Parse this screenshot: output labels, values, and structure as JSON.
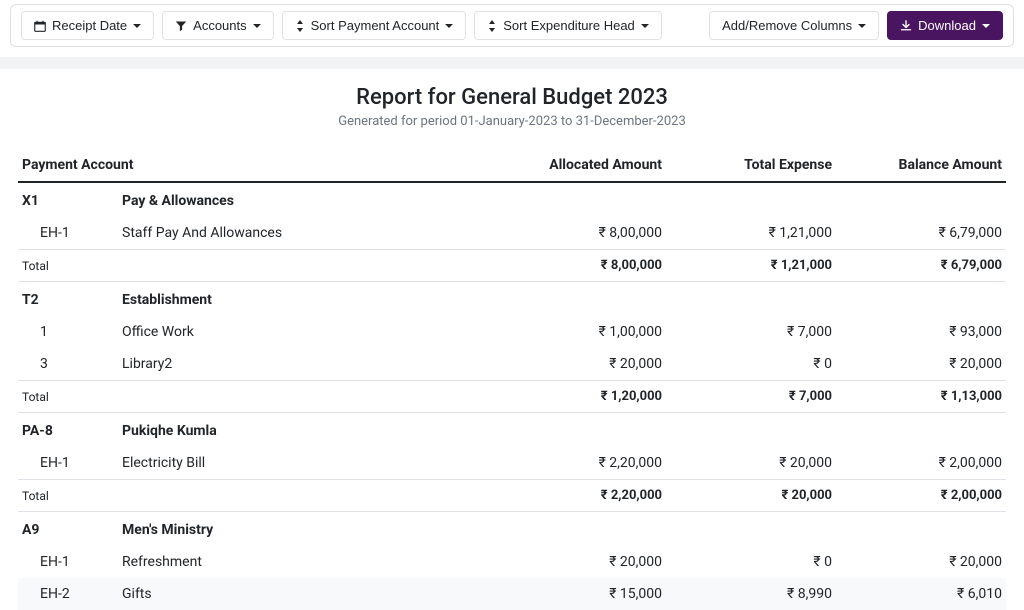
{
  "toolbar": {
    "receipt_date": "Receipt Date",
    "accounts": "Accounts",
    "sort_payment_account": "Sort Payment Account",
    "sort_expenditure_head": "Sort Expenditure Head",
    "add_remove_columns": "Add/Remove Columns",
    "download": "Download"
  },
  "report": {
    "title": "Report for General Budget 2023",
    "subtitle": "Generated for period 01-January-2023 to 31-December-2023"
  },
  "columns": {
    "payment_account": "Payment Account",
    "allocated_amount": "Allocated Amount",
    "total_expense": "Total Expense",
    "balance_amount": "Balance Amount"
  },
  "groups": [
    {
      "code": "X1",
      "name": "Pay & Allowances",
      "rows": [
        {
          "code": "EH-1",
          "label": "Staff Pay And Allowances",
          "allocated": "₹ 8,00,000",
          "expense": "₹ 1,21,000",
          "balance": "₹ 6,79,000"
        }
      ],
      "total": {
        "label": "Total",
        "allocated": "₹ 8,00,000",
        "expense": "₹ 1,21,000",
        "balance": "₹ 6,79,000"
      }
    },
    {
      "code": "T2",
      "name": "Establishment",
      "rows": [
        {
          "code": "1",
          "label": "Office Work",
          "allocated": "₹ 1,00,000",
          "expense": "₹ 7,000",
          "balance": "₹ 93,000"
        },
        {
          "code": "3",
          "label": "Library2",
          "allocated": "₹ 20,000",
          "expense": "₹ 0",
          "balance": "₹ 20,000"
        }
      ],
      "total": {
        "label": "Total",
        "allocated": "₹ 1,20,000",
        "expense": "₹ 7,000",
        "balance": "₹ 1,13,000"
      }
    },
    {
      "code": "PA-8",
      "name": "Pukiqhe Kumla",
      "rows": [
        {
          "code": "EH-1",
          "label": "Electricity Bill",
          "allocated": "₹ 2,20,000",
          "expense": "₹ 20,000",
          "balance": "₹ 2,00,000"
        }
      ],
      "total": {
        "label": "Total",
        "allocated": "₹ 2,20,000",
        "expense": "₹ 20,000",
        "balance": "₹ 2,00,000"
      }
    },
    {
      "code": "A9",
      "name": "Men's Ministry",
      "rows": [
        {
          "code": "EH-1",
          "label": "Refreshment",
          "allocated": "₹ 20,000",
          "expense": "₹ 0",
          "balance": "₹ 20,000"
        },
        {
          "code": "EH-2",
          "label": "Gifts",
          "allocated": "₹ 15,000",
          "expense": "₹ 8,990",
          "balance": "₹ 6,010",
          "zebra": true
        }
      ]
    }
  ]
}
